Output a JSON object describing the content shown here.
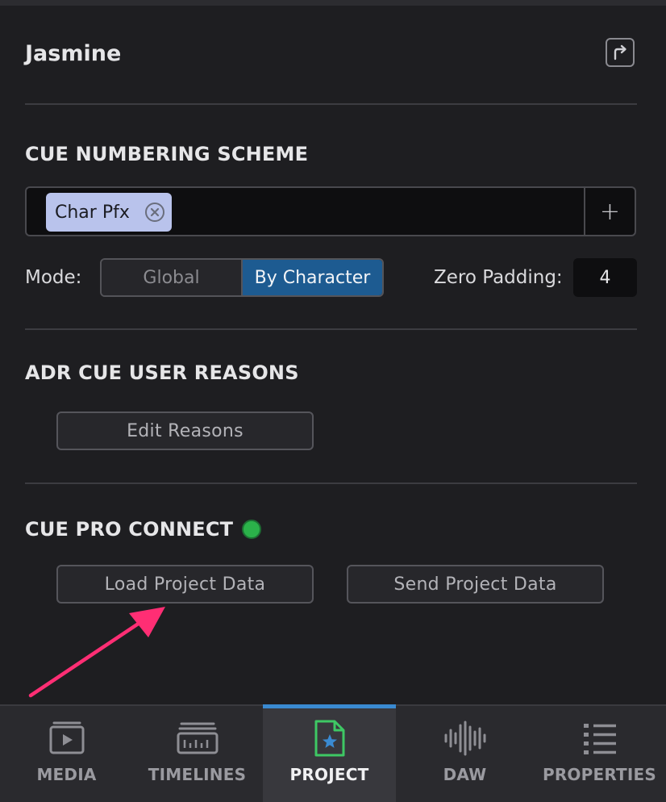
{
  "panel": {
    "title": "Jasmine"
  },
  "cue_numbering": {
    "heading": "CUE NUMBERING SCHEME",
    "tokens": [
      "Char Pfx"
    ],
    "add_label": "+",
    "mode_label": "Mode:",
    "mode_options": [
      "Global",
      "By Character"
    ],
    "mode_selected": "By Character",
    "zero_padding_label": "Zero Padding:",
    "zero_padding_value": "4"
  },
  "adr_reasons": {
    "heading": "ADR CUE USER REASONS",
    "edit_label": "Edit Reasons"
  },
  "cue_pro_connect": {
    "heading": "CUE PRO CONNECT",
    "status_color": "#2bb24a",
    "load_label": "Load Project Data",
    "send_label": "Send Project Data"
  },
  "tabs": [
    {
      "label": "MEDIA",
      "icon": "media-icon"
    },
    {
      "label": "TIMELINES",
      "icon": "timelines-icon"
    },
    {
      "label": "PROJECT",
      "icon": "project-icon",
      "active": true
    },
    {
      "label": "DAW",
      "icon": "waveform-icon"
    },
    {
      "label": "PROPERTIES",
      "icon": "properties-icon"
    }
  ],
  "colors": {
    "accent": "#3a8ad1",
    "selected_segment": "#1d5b91",
    "annotation_arrow": "#ff2e74",
    "chip": "#b9c3ec"
  }
}
